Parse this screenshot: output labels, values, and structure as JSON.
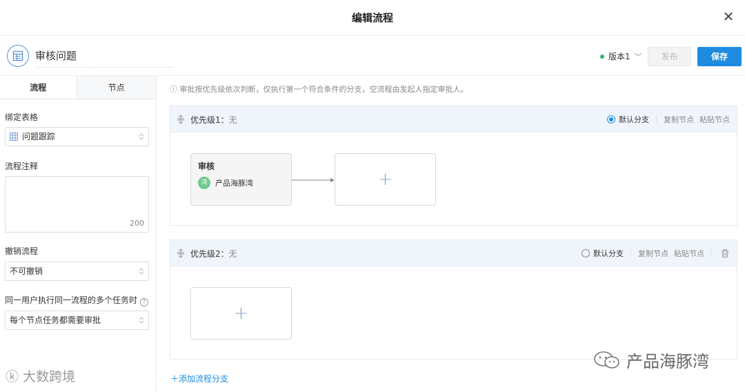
{
  "dialog": {
    "title": "编辑流程"
  },
  "header": {
    "form_name": "审核问题",
    "version_label": "版本1",
    "publish_label": "发布",
    "save_label": "保存"
  },
  "sidebar": {
    "tabs": [
      {
        "label": "流程",
        "active": true
      },
      {
        "label": "节点",
        "active": false
      }
    ],
    "bind_table_label": "绑定表格",
    "bind_table_value": "问题跟踪",
    "note_label": "流程注释",
    "note_count": "200",
    "revoke_label": "撤销流程",
    "revoke_value": "不可撤销",
    "multi_task_label": "同一用户执行同一流程的多个任务时",
    "multi_task_value": "每个节点任务都需要审批"
  },
  "main": {
    "notice": "ⓘ 审批按优先级依次判断，仅执行第一个符合条件的分支，空流程由发起人指定审批人。",
    "branches": [
      {
        "priority_label": "优先级1：",
        "condition": "无",
        "default_label": "默认分支",
        "default_selected": true,
        "copy_label": "复制节点",
        "paste_label": "粘贴节点",
        "node": {
          "title": "审核",
          "approver": "产品海豚湾",
          "avatar_text": "湾"
        }
      },
      {
        "priority_label": "优先级2：",
        "condition": "无",
        "default_label": "默认分支",
        "default_selected": false,
        "copy_label": "复制节点",
        "paste_label": "粘贴节点"
      }
    ],
    "add_branch_label": "添加流程分支"
  },
  "watermarks": {
    "left": "大数跨境",
    "right": "产品海豚湾"
  },
  "colors": {
    "primary": "#1d8be0",
    "status_green": "#2fb86a",
    "branch_header_bg": "#f0f5fb"
  }
}
